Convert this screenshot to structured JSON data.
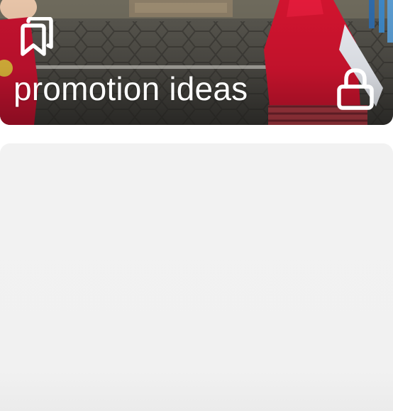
{
  "collection_card": {
    "title": "promotion ideas",
    "bookmark_icon": "bookmark-stack-icon",
    "lock_icon": "lock-icon",
    "thumbnail": "photo-thumbnail"
  },
  "empty_card": {
    "thumbnail": "empty-thumbnail"
  }
}
